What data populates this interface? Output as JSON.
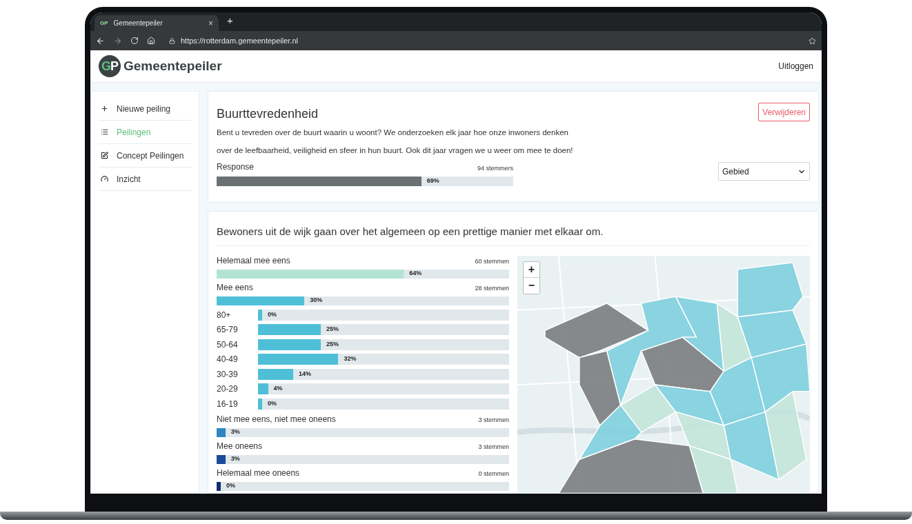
{
  "browser": {
    "tab_logo": "GP",
    "tab_title": "Gemeentepeiler",
    "close": "×",
    "new_tab": "+",
    "url": "https://rotterdam.gemeentepeiler.nl"
  },
  "header": {
    "logo_letters": [
      "G",
      "P"
    ],
    "brand": "Gemeentepeiler",
    "logout": "Uitloggen"
  },
  "sidebar": {
    "items": [
      {
        "label": "Nieuwe peiling",
        "selected": false,
        "kind": "plus"
      },
      {
        "label": "Peilingen",
        "selected": true,
        "kind": "list"
      },
      {
        "label": "Concept Peilingen",
        "selected": false,
        "kind": "edit"
      },
      {
        "label": "Inzicht",
        "selected": false,
        "kind": "gauge"
      }
    ]
  },
  "poll": {
    "title": "Buurttevredenheid",
    "delete": "Verwijderen",
    "description": [
      "Bent u tevreden over de buurt waarin u woont? We onderzoeken elk jaar hoe onze inwoners denken",
      "over de leefbaarheid, veiligheid en sfeer in hun buurt. Ook dit jaar vragen we u weer om mee te doen!"
    ],
    "response": {
      "label": "Response",
      "count": "94 stemmers",
      "level": 0.69,
      "percent": "69%"
    },
    "filter": {
      "value": "Gebied"
    }
  },
  "question": {
    "title": "Bewoners uit de wijk gaan over het algemeen op een prettige manier met elkaar om.",
    "answers": [
      {
        "label": "Helemaal mee eens",
        "count": "60 stemmen",
        "level": 0.64,
        "percent": "64%",
        "color": "#b3e3d3"
      },
      {
        "label": "Mee eens",
        "count": "28 stemmen",
        "level": 0.3,
        "percent": "30%",
        "color": "#4fbfd8",
        "age_groups": [
          {
            "label": "80+",
            "level": 0.0,
            "percent": "0%"
          },
          {
            "label": "65-79",
            "level": 0.25,
            "percent": "25%"
          },
          {
            "label": "50-64",
            "level": 0.25,
            "percent": "25%"
          },
          {
            "label": "40-49",
            "level": 0.32,
            "percent": "32%"
          },
          {
            "label": "30-39",
            "level": 0.14,
            "percent": "14%"
          },
          {
            "label": "20-29",
            "level": 0.04,
            "percent": "4%"
          },
          {
            "label": "16-19",
            "level": 0.0,
            "percent": "0%"
          }
        ]
      },
      {
        "label": "Niet mee eens, niet mee oneens",
        "count": "3 stemmen",
        "level": 0.03,
        "percent": "3%",
        "color": "#2e86c1"
      },
      {
        "label": "Mee oneens",
        "count": "3 stemmen",
        "level": 0.03,
        "percent": "3%",
        "color": "#1a4a9a"
      },
      {
        "label": "Helemaal mee oneens",
        "count": "0 stemmen",
        "level": 0.0,
        "percent": "0%",
        "color": "#123070"
      }
    ],
    "map": {
      "zoom_in": "+",
      "zoom_out": "−"
    }
  }
}
